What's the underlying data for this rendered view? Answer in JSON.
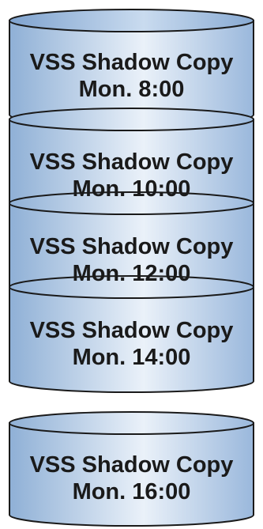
{
  "diagram": {
    "cylinders": [
      {
        "title": "VSS Shadow Copy",
        "time": "Mon. 8:00"
      },
      {
        "title": "VSS Shadow Copy",
        "time": "Mon. 10:00"
      },
      {
        "title": "VSS Shadow Copy",
        "time": "Mon. 12:00"
      },
      {
        "title": "VSS Shadow Copy",
        "time": "Mon. 14:00"
      },
      {
        "title": "VSS Shadow Copy",
        "time": "Mon. 16:00"
      }
    ],
    "colors": {
      "fill_edge": "#8fb0d6",
      "fill_center": "#eaf1f9",
      "outline": "#1a1a1a"
    }
  }
}
